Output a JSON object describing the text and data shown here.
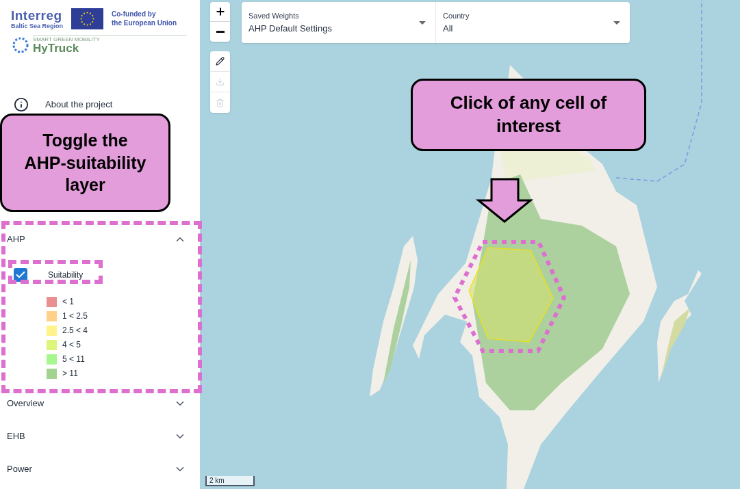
{
  "logos": {
    "interreg": "Interreg",
    "interreg_sub": "Baltic Sea Region",
    "eu_lines": [
      "Co-funded by",
      "the European Union"
    ],
    "hytruck_tagline": "SMART GREEN MOBILITY",
    "hytruck": "HyTruck"
  },
  "nav": [
    {
      "label": "About the project"
    }
  ],
  "layer_groups": [
    {
      "title": "AHP",
      "expanded": true,
      "layers": [
        {
          "label": "Suitability",
          "checked": true
        }
      ],
      "legend": [
        {
          "label": "< 1",
          "color": "#e88f8f"
        },
        {
          "label": "1 < 2.5",
          "color": "#ffd08a"
        },
        {
          "label": "2.5 < 4",
          "color": "#fff38a"
        },
        {
          "label": "4 < 5",
          "color": "#dcf57a"
        },
        {
          "label": "5 < 11",
          "color": "#a6f78e"
        },
        {
          "label": "> 11",
          "color": "#a3d391"
        }
      ]
    },
    {
      "title": "Overview",
      "expanded": false
    },
    {
      "title": "EHB",
      "expanded": false
    },
    {
      "title": "Power",
      "expanded": false
    }
  ],
  "draw_tools": [
    {
      "kind": "pencil",
      "disabled": false
    },
    {
      "kind": "download",
      "disabled": true
    },
    {
      "kind": "trash",
      "disabled": true
    }
  ],
  "filters": [
    {
      "label": "Saved Weights",
      "value": "AHP Default Settings"
    },
    {
      "label": "Country",
      "value": "All"
    }
  ],
  "scale": "2 km",
  "callouts": [
    {
      "kind": "sidebar",
      "lines": [
        "Toggle the",
        "AHP-suitability",
        "layer"
      ]
    },
    {
      "kind": "map",
      "lines": [
        "Click of any cell of",
        "interest"
      ]
    }
  ]
}
